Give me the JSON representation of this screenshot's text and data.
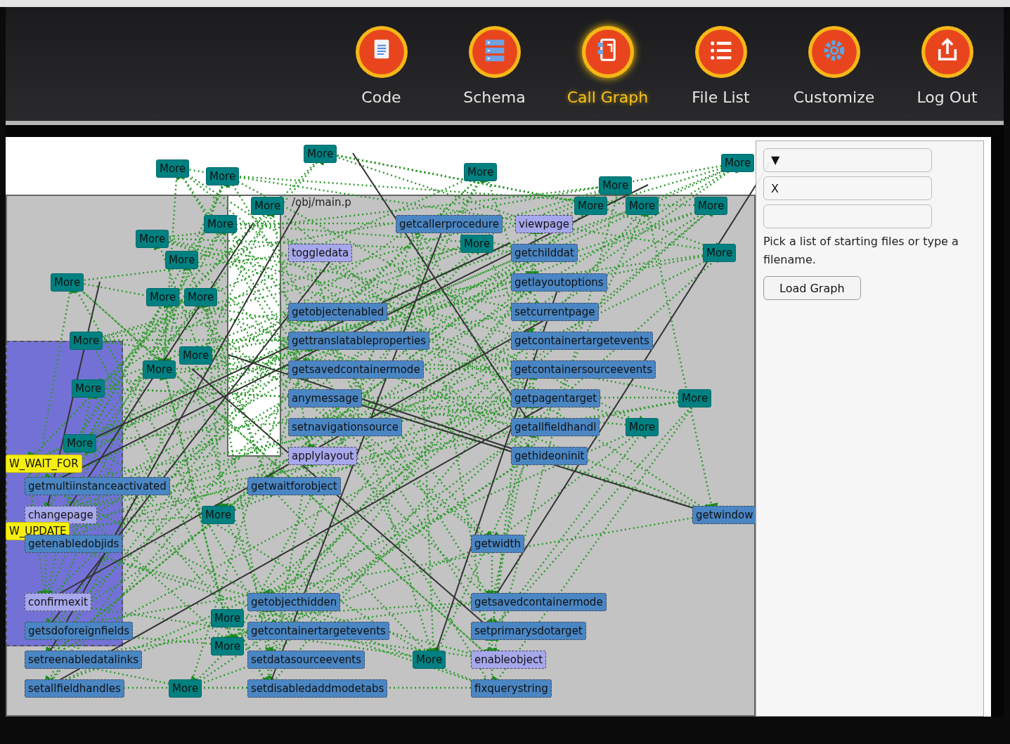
{
  "nav": [
    {
      "label": "Code",
      "kind": "code",
      "selected": false
    },
    {
      "label": "Schema",
      "kind": "schema",
      "selected": false
    },
    {
      "label": "Call Graph",
      "kind": "callgraph",
      "selected": true
    },
    {
      "label": "File List",
      "kind": "filelist",
      "selected": false
    },
    {
      "label": "Customize",
      "kind": "customize",
      "selected": false
    },
    {
      "label": "Log Out",
      "kind": "logout",
      "selected": false
    }
  ],
  "graph": {
    "cluster_label": "/obj/main.p",
    "nodes": [
      {
        "label": "More",
        "kind": "more"
      },
      {
        "label": "More",
        "kind": "more"
      },
      {
        "label": "More",
        "kind": "more"
      },
      {
        "label": "More",
        "kind": "more"
      },
      {
        "label": "More",
        "kind": "more"
      },
      {
        "label": "More",
        "kind": "more"
      },
      {
        "label": "More",
        "kind": "more"
      },
      {
        "label": "More",
        "kind": "more"
      },
      {
        "label": "More",
        "kind": "more"
      },
      {
        "label": "More",
        "kind": "more"
      },
      {
        "label": "More",
        "kind": "more"
      },
      {
        "label": "getcallerprocedure",
        "kind": "function"
      },
      {
        "label": "viewpage",
        "kind": "page"
      },
      {
        "label": "More",
        "kind": "more"
      },
      {
        "label": "More",
        "kind": "more"
      },
      {
        "label": "toggledata",
        "kind": "page"
      },
      {
        "label": "getchilddat",
        "kind": "function"
      },
      {
        "label": "More",
        "kind": "more"
      },
      {
        "label": "More",
        "kind": "more"
      },
      {
        "label": "More",
        "kind": "more"
      },
      {
        "label": "getlayoutoptions",
        "kind": "function"
      },
      {
        "label": "More",
        "kind": "more"
      },
      {
        "label": "More",
        "kind": "more"
      },
      {
        "label": "getobjectenabled",
        "kind": "function"
      },
      {
        "label": "setcurrentpage",
        "kind": "function"
      },
      {
        "label": "More",
        "kind": "more"
      },
      {
        "label": "gettranslatableproperties",
        "kind": "function"
      },
      {
        "label": "getcontainertargetevents",
        "kind": "function"
      },
      {
        "label": "More",
        "kind": "more"
      },
      {
        "label": "More",
        "kind": "more"
      },
      {
        "label": "getsavedcontainermode",
        "kind": "function"
      },
      {
        "label": "getcontainersourceevents",
        "kind": "function"
      },
      {
        "label": "More",
        "kind": "more"
      },
      {
        "label": "anymessage",
        "kind": "function"
      },
      {
        "label": "getpagentarget",
        "kind": "function"
      },
      {
        "label": "More",
        "kind": "more"
      },
      {
        "label": "setnavigationsource",
        "kind": "function"
      },
      {
        "label": "getallfieldhandl",
        "kind": "function"
      },
      {
        "label": "More",
        "kind": "more"
      },
      {
        "label": "More",
        "kind": "more"
      },
      {
        "label": "applylayout",
        "kind": "page"
      },
      {
        "label": "gethideoninit",
        "kind": "function"
      },
      {
        "label": "W_WAIT_FOR",
        "kind": "warning"
      },
      {
        "label": "getmultiinstanceactivated",
        "kind": "function"
      },
      {
        "label": "getwaitforobject",
        "kind": "function"
      },
      {
        "label": "changepage",
        "kind": "page"
      },
      {
        "label": "More",
        "kind": "more"
      },
      {
        "label": "getwindow",
        "kind": "function"
      },
      {
        "label": "W_UPDATE",
        "kind": "warning"
      },
      {
        "label": "getenabledobjids",
        "kind": "function"
      },
      {
        "label": "getwidth",
        "kind": "function"
      },
      {
        "label": "confirmexit",
        "kind": "page"
      },
      {
        "label": "getobjecthidden",
        "kind": "function"
      },
      {
        "label": "getsavedcontainermode",
        "kind": "function"
      },
      {
        "label": "More",
        "kind": "more"
      },
      {
        "label": "getsdoforeignfields",
        "kind": "function"
      },
      {
        "label": "getcontainertargetevents",
        "kind": "function"
      },
      {
        "label": "setprimarysdotarget",
        "kind": "function"
      },
      {
        "label": "More",
        "kind": "more"
      },
      {
        "label": "setreenabledatalinks",
        "kind": "function"
      },
      {
        "label": "setdatasourceevents",
        "kind": "function"
      },
      {
        "label": "More",
        "kind": "more"
      },
      {
        "label": "enableobject",
        "kind": "page"
      },
      {
        "label": "setallfieldhandles",
        "kind": "function"
      },
      {
        "label": "More",
        "kind": "more"
      },
      {
        "label": "setdisabledaddmodetabs",
        "kind": "function"
      },
      {
        "label": "fixquerystring",
        "kind": "function"
      }
    ]
  },
  "panel": {
    "dropdown": "▼",
    "field_value": "X",
    "hint": "Pick a list of starting files or type a filename.",
    "button": "Load Graph"
  }
}
